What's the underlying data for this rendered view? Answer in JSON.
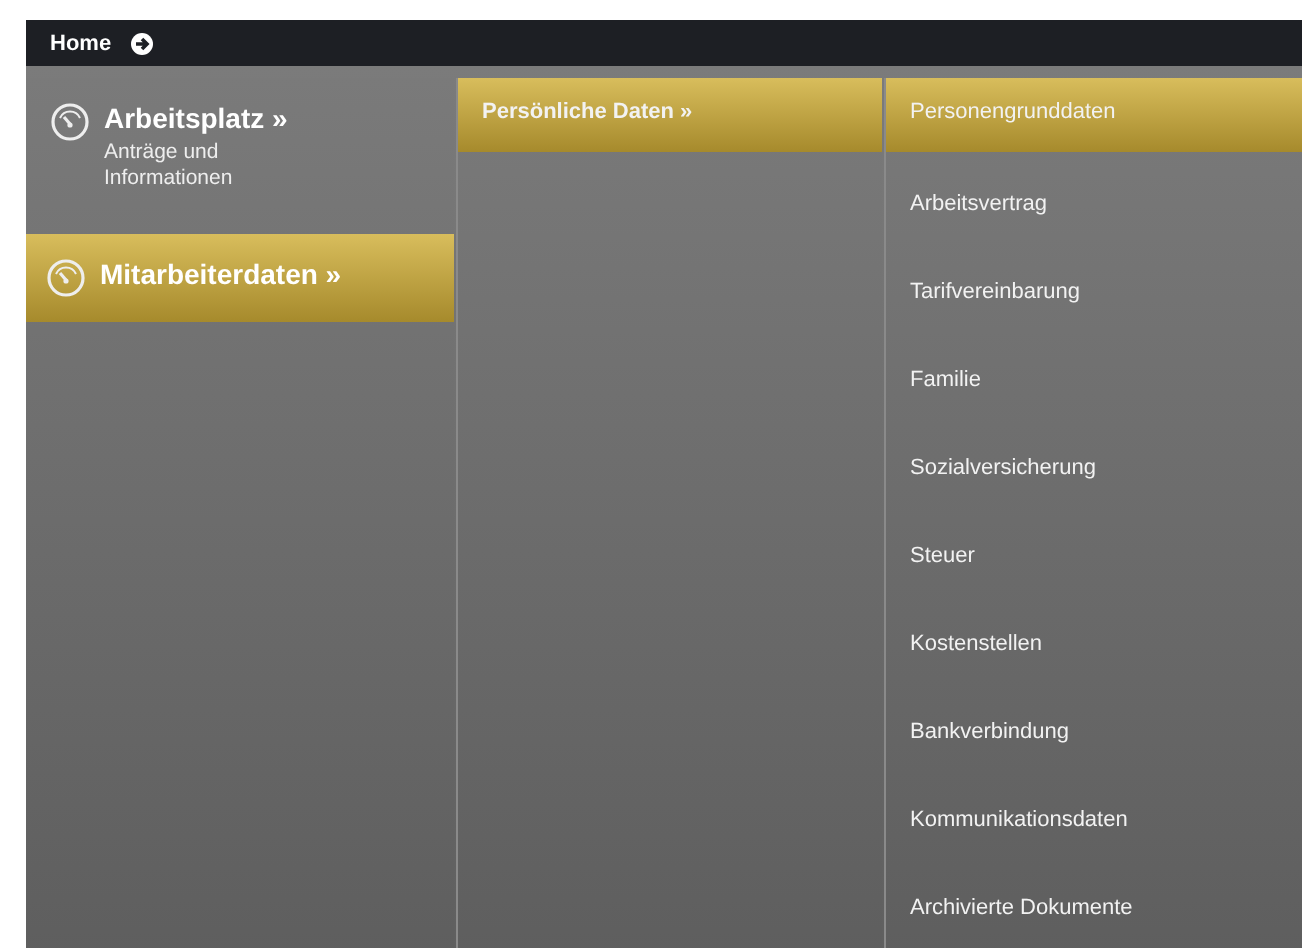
{
  "top_bar": {
    "home": "Home"
  },
  "columns": [
    {
      "items": [
        {
          "label": "Arbeitsplatz »",
          "subtitle": "Anträge und Informationen",
          "selected": false
        },
        {
          "label": "Mitarbeiterdaten »",
          "selected": true
        }
      ]
    },
    {
      "items": [
        {
          "label": "Persönliche Daten »",
          "selected": true
        }
      ]
    },
    {
      "items": [
        {
          "label": "Personengrunddaten",
          "selected": true
        },
        {
          "label": "Arbeitsvertrag",
          "selected": false
        },
        {
          "label": "Tarifvereinbarung",
          "selected": false
        },
        {
          "label": "Familie",
          "selected": false
        },
        {
          "label": "Sozialversicherung",
          "selected": false
        },
        {
          "label": "Steuer",
          "selected": false
        },
        {
          "label": "Kostenstellen",
          "selected": false
        },
        {
          "label": "Bankverbindung",
          "selected": false
        },
        {
          "label": "Kommunikationsdaten",
          "selected": false
        },
        {
          "label": "Archivierte Dokumente",
          "selected": false
        }
      ]
    }
  ]
}
